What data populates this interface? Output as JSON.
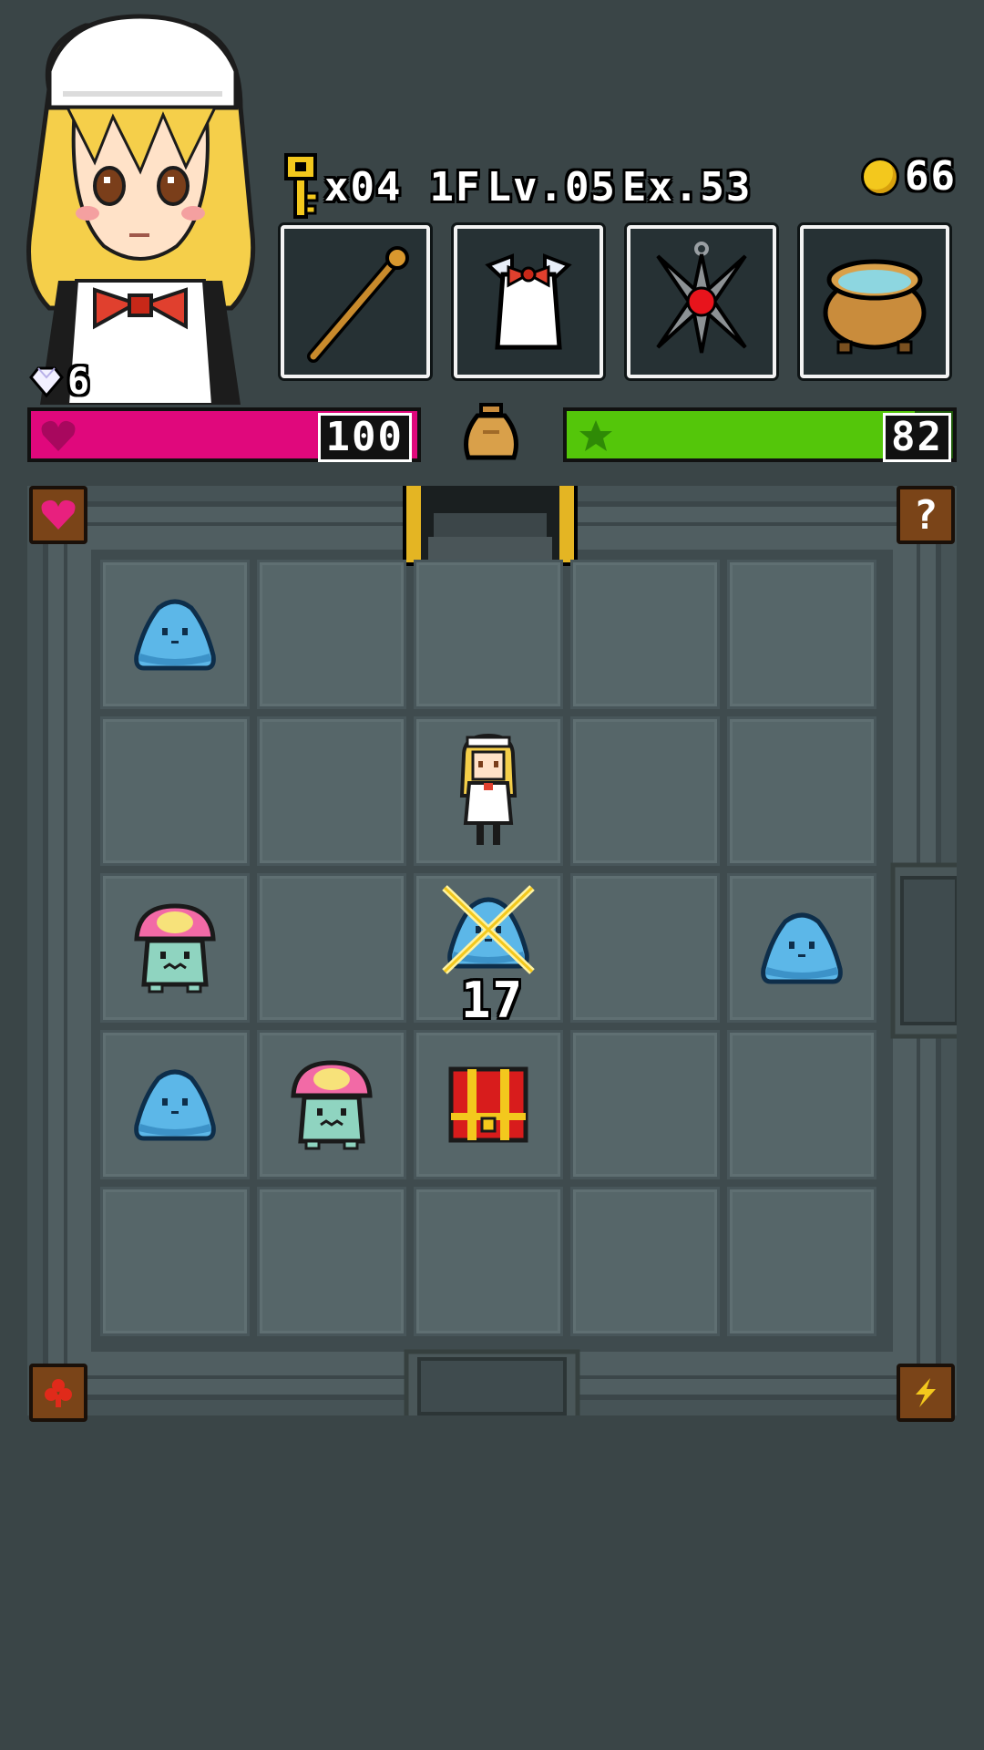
{
  "hud": {
    "keys": "x04",
    "floor": "1F",
    "level": "Lv.05",
    "exp": "Ex.53",
    "gold": "66",
    "gems": "6"
  },
  "bars": {
    "hp": {
      "value": "100",
      "fill": 1.0,
      "color": "#e0087c"
    },
    "sp": {
      "value": "82",
      "fill": 0.9,
      "color": "#54c60a"
    }
  },
  "equipment": [
    "staff-icon",
    "armor-icon",
    "amulet-icon",
    "pot-icon"
  ],
  "board": {
    "damage_number": "17"
  },
  "corner_buttons": [
    "heart-icon",
    "help-icon",
    "clover-icon",
    "lightning-icon"
  ]
}
